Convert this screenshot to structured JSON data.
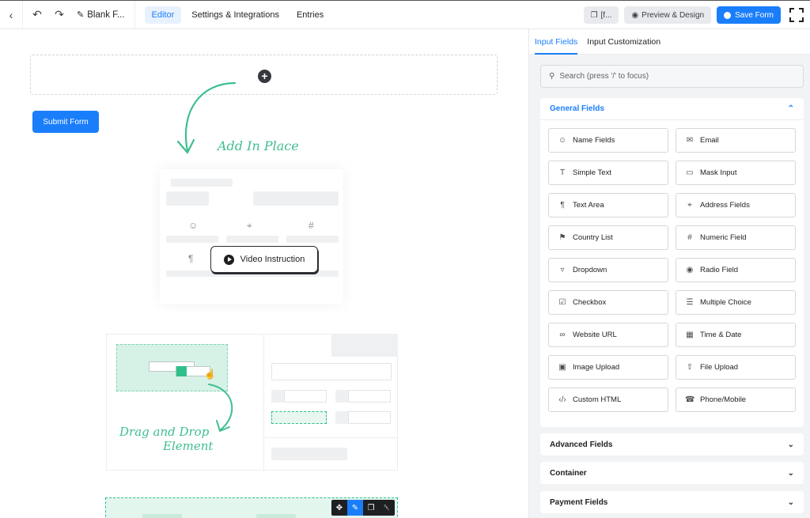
{
  "topbar": {
    "form_name": "Blank F...",
    "tabs": [
      {
        "label": "Editor",
        "active": true
      },
      {
        "label": "Settings & Integrations",
        "active": false
      },
      {
        "label": "Entries",
        "active": false
      }
    ],
    "shortcode_label": "[f...",
    "preview_label": "Preview & Design",
    "save_label": "Save Form"
  },
  "canvas": {
    "submit_label": "Submit Form",
    "add_in_place_label": "Add In Place",
    "video_label": "Video Instruction",
    "drag_line1": "Drag and Drop",
    "drag_line2": "Element"
  },
  "sidebar": {
    "tabs": [
      {
        "label": "Input Fields",
        "active": true
      },
      {
        "label": "Input Customization",
        "active": false
      }
    ],
    "search_placeholder": "Search (press '/' to focus)",
    "general_title": "General Fields",
    "fields": [
      {
        "label": "Name Fields",
        "icon": "user-icon"
      },
      {
        "label": "Email",
        "icon": "envelope-icon"
      },
      {
        "label": "Simple Text",
        "icon": "text-icon"
      },
      {
        "label": "Mask Input",
        "icon": "mask-icon"
      },
      {
        "label": "Text Area",
        "icon": "paragraph-icon"
      },
      {
        "label": "Address Fields",
        "icon": "location-pin-icon"
      },
      {
        "label": "Country List",
        "icon": "flag-icon"
      },
      {
        "label": "Numeric Field",
        "icon": "hash-icon"
      },
      {
        "label": "Dropdown",
        "icon": "dropdown-icon"
      },
      {
        "label": "Radio Field",
        "icon": "radio-icon"
      },
      {
        "label": "Checkbox",
        "icon": "checkbox-icon"
      },
      {
        "label": "Multiple Choice",
        "icon": "list-icon"
      },
      {
        "label": "Website URL",
        "icon": "link-icon"
      },
      {
        "label": "Time & Date",
        "icon": "calendar-icon"
      },
      {
        "label": "Image Upload",
        "icon": "image-icon"
      },
      {
        "label": "File Upload",
        "icon": "upload-icon"
      },
      {
        "label": "Custom HTML",
        "icon": "code-icon"
      },
      {
        "label": "Phone/Mobile",
        "icon": "phone-icon"
      }
    ],
    "collapsed_panels": [
      "Advanced Fields",
      "Container",
      "Payment Fields"
    ]
  }
}
